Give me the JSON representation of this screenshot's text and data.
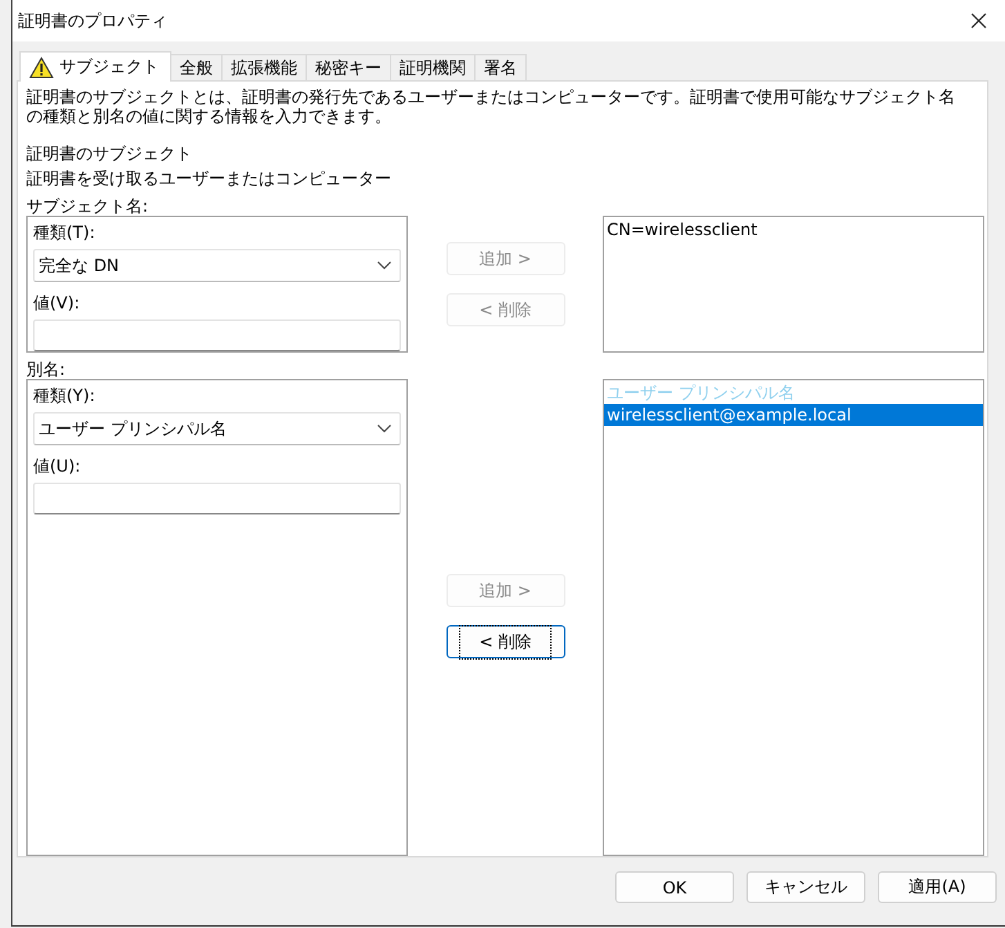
{
  "window": {
    "title": "証明書のプロパティ"
  },
  "tabs": [
    {
      "label": "サブジェクト",
      "selected": true,
      "warning": true
    },
    {
      "label": "全般",
      "selected": false,
      "warning": false
    },
    {
      "label": "拡張機能",
      "selected": false,
      "warning": false
    },
    {
      "label": "秘密キー",
      "selected": false,
      "warning": false
    },
    {
      "label": "証明機関",
      "selected": false,
      "warning": false
    },
    {
      "label": "署名",
      "selected": false,
      "warning": false
    }
  ],
  "description": "証明書のサブジェクトとは、証明書の発行先であるユーザーまたはコンピューターです。証明書で使用可能なサブジェクト名の種類と別名の値に関する情報を入力できます。",
  "section_title": "証明書のサブジェクト",
  "section_subtitle": "証明書を受け取るユーザーまたはコンピューター",
  "groups": [
    {
      "label": "サブジェクト名:",
      "type_label": "種類(T):",
      "type_value": "完全な DN",
      "value_label": "値(V):",
      "add_button": {
        "label": "追加 >",
        "disabled": true,
        "focused": false
      },
      "remove_button": {
        "label": "< 削除",
        "disabled": true,
        "focused": false
      },
      "list": [
        {
          "text": "CN=wirelessclient",
          "kind": "item",
          "selected": false
        }
      ]
    },
    {
      "label": "別名:",
      "type_label": "種類(Y):",
      "type_value": "ユーザー プリンシパル名",
      "value_label": "値(U):",
      "add_button": {
        "label": "追加 >",
        "disabled": true,
        "focused": false
      },
      "remove_button": {
        "label": "< 削除",
        "disabled": false,
        "focused": true
      },
      "list": [
        {
          "text": "ユーザー プリンシパル名",
          "kind": "header",
          "selected": false
        },
        {
          "text": "wirelessclient@example.local",
          "kind": "item",
          "selected": true
        }
      ]
    }
  ],
  "buttons": [
    {
      "label": "OK"
    },
    {
      "label": "キャンセル"
    },
    {
      "label": "適用(A)"
    }
  ]
}
